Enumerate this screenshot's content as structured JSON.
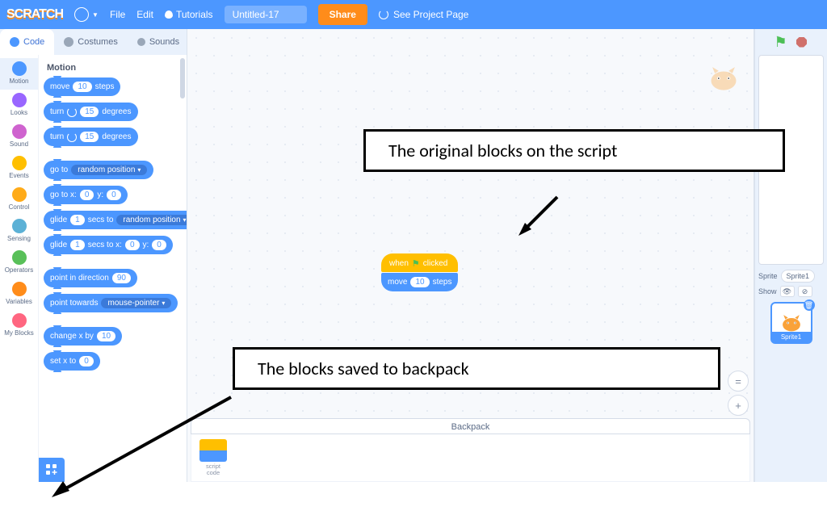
{
  "topbar": {
    "logo": "SCRATCH",
    "file": "File",
    "edit": "Edit",
    "tutorials": "Tutorials",
    "project_name": "Untitled-17",
    "share": "Share",
    "see_project": "See Project Page"
  },
  "tabs": {
    "code": "Code",
    "costumes": "Costumes",
    "sounds": "Sounds"
  },
  "categories": [
    {
      "name": "Motion",
      "color": "#4c97ff"
    },
    {
      "name": "Looks",
      "color": "#9966ff"
    },
    {
      "name": "Sound",
      "color": "#cf63cf"
    },
    {
      "name": "Events",
      "color": "#ffbf00"
    },
    {
      "name": "Control",
      "color": "#ffab19"
    },
    {
      "name": "Sensing",
      "color": "#5cb1d6"
    },
    {
      "name": "Operators",
      "color": "#59c059"
    },
    {
      "name": "Variables",
      "color": "#ff8c1a"
    },
    {
      "name": "My Blocks",
      "color": "#ff6680"
    }
  ],
  "palette": {
    "heading": "Motion",
    "blocks": {
      "move_steps": {
        "pre": "move",
        "val": "10",
        "post": "steps"
      },
      "turn_cw": {
        "pre": "turn",
        "val": "15",
        "post": "degrees"
      },
      "turn_ccw": {
        "pre": "turn",
        "val": "15",
        "post": "degrees"
      },
      "goto": {
        "pre": "go to",
        "dd": "random position"
      },
      "goto_xy": {
        "pre": "go to x:",
        "x": "0",
        "mid": "y:",
        "y": "0"
      },
      "glide_to": {
        "pre": "glide",
        "secs": "1",
        "mid": "secs to",
        "dd": "random position"
      },
      "glide_xy": {
        "pre": "glide",
        "secs": "1",
        "mid": "secs to x:",
        "x": "0",
        "mid2": "y:",
        "y": "0"
      },
      "point_dir": {
        "pre": "point in direction",
        "val": "90"
      },
      "point_towards": {
        "pre": "point towards",
        "dd": "mouse-pointer"
      },
      "change_x": {
        "pre": "change x by",
        "val": "10"
      },
      "set_x": {
        "pre": "set x to",
        "val": "0"
      }
    }
  },
  "script": {
    "hat": {
      "pre": "when",
      "post": "clicked"
    },
    "move": {
      "pre": "move",
      "val": "10",
      "post": "steps"
    }
  },
  "backpack": {
    "label": "Backpack",
    "item": {
      "line1": "script",
      "line2": "code"
    }
  },
  "sprite_info": {
    "label": "Sprite",
    "name": "Sprite1",
    "show": "Show",
    "thumb_name": "Sprite1"
  },
  "annotations": {
    "a1": "The original blocks on the script",
    "a2": "The blocks saved to backpack"
  }
}
